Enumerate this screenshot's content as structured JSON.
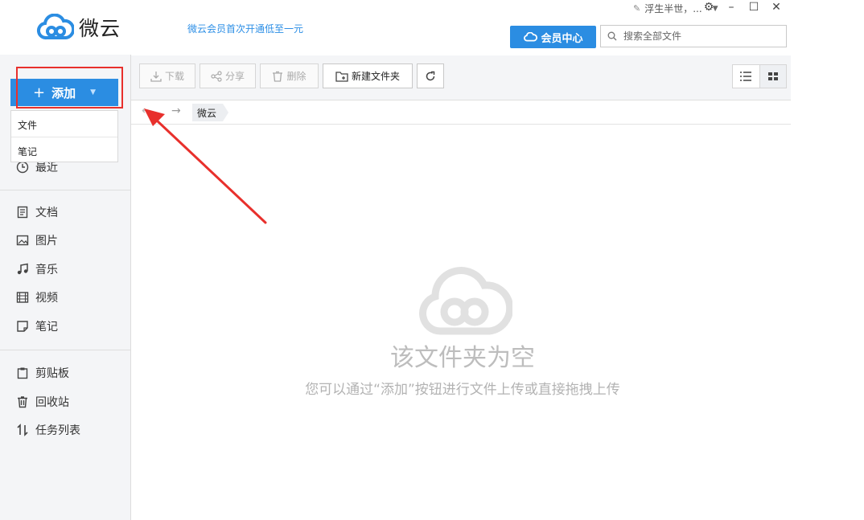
{
  "header": {
    "logo_text": "微云",
    "promo": "微云会员首次开通低至一元",
    "user_name": "浮生半世，...",
    "vip_label": "会员中心",
    "search_placeholder": "搜索全部文件"
  },
  "sidebar": {
    "add_label": "添加",
    "add_menu": [
      "文件",
      "笔记"
    ],
    "items": [
      {
        "label": "最近",
        "icon": "clock-icon"
      },
      {
        "label": "文档",
        "icon": "document-icon"
      },
      {
        "label": "图片",
        "icon": "image-icon"
      },
      {
        "label": "音乐",
        "icon": "music-icon"
      },
      {
        "label": "视频",
        "icon": "video-icon"
      },
      {
        "label": "笔记",
        "icon": "note-icon"
      },
      {
        "label": "剪贴板",
        "icon": "clipboard-icon"
      },
      {
        "label": "回收站",
        "icon": "trash-icon"
      },
      {
        "label": "任务列表",
        "icon": "transfer-icon"
      }
    ]
  },
  "toolbar": {
    "download": "下载",
    "share": "分享",
    "delete": "删除",
    "new_folder": "新建文件夹"
  },
  "breadcrumb": {
    "current": "微云"
  },
  "empty": {
    "title": "该文件夹为空",
    "subtitle": "您可以通过“添加”按钮进行文件上传或直接拖拽上传"
  },
  "colors": {
    "accent": "#2b8de2",
    "highlight": "#e8302c"
  }
}
